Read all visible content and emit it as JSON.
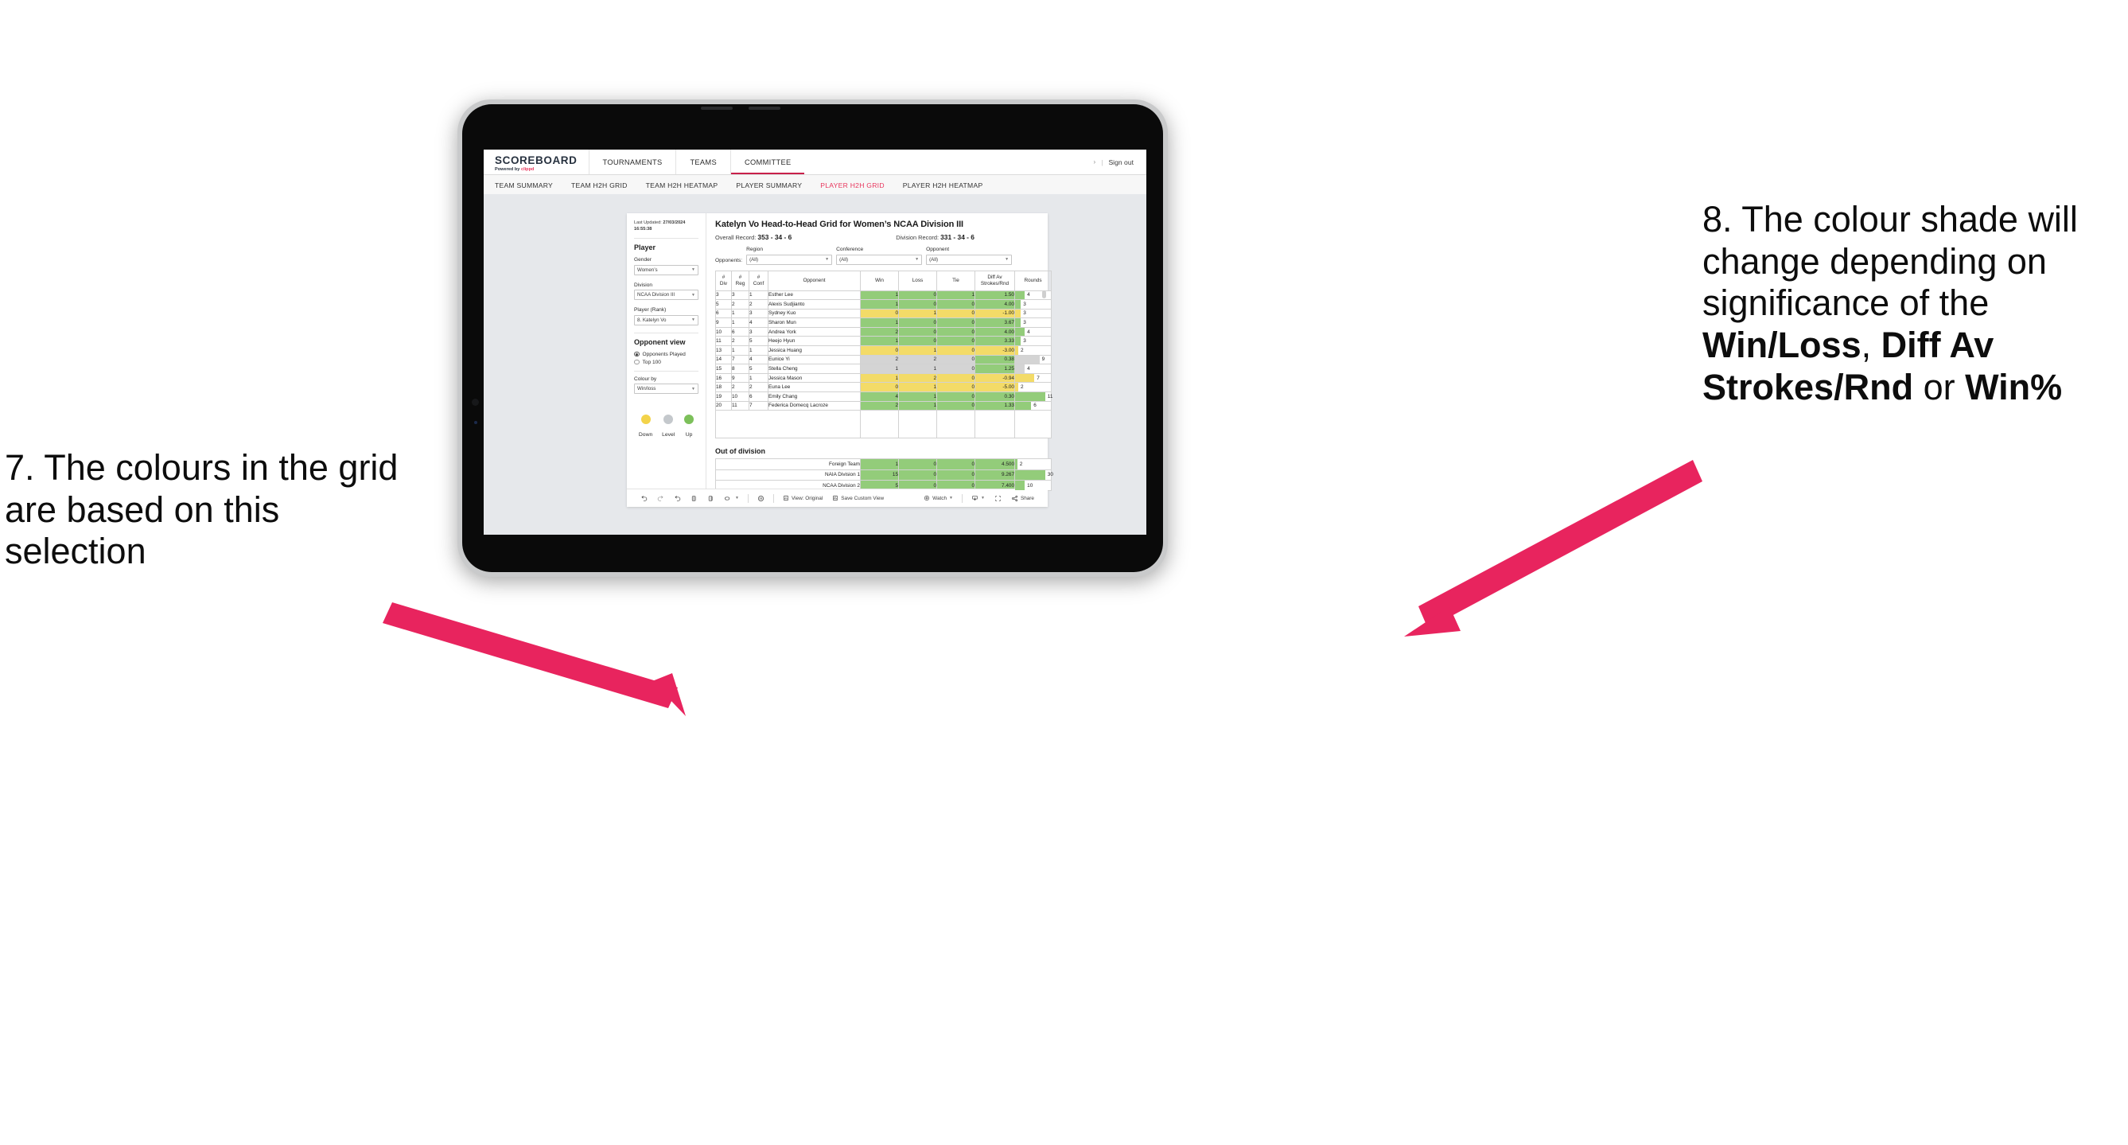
{
  "annotations": {
    "left": "7. The colours in the grid are based on this selection",
    "right_pre": "8. The colour shade will change depending on significance of the ",
    "right_b1": "Win/Loss",
    "right_mid1": ", ",
    "right_b2": "Diff Av Strokes/Rnd",
    "right_mid2": " or ",
    "right_b3": "Win%",
    "arrow_color": "#e8245e"
  },
  "app": {
    "logo": {
      "name": "SCOREBOARD",
      "tagline_pre": "Powered by ",
      "tagline_brand": "clippd"
    },
    "top_nav": [
      {
        "label": "TOURNAMENTS",
        "active": false
      },
      {
        "label": "TEAMS",
        "active": false
      },
      {
        "label": "COMMITTEE",
        "active": true
      }
    ],
    "sign_out": {
      "chevron": "›",
      "divider": "|",
      "label": "Sign out"
    },
    "sub_nav": [
      {
        "label": "TEAM SUMMARY",
        "active": false
      },
      {
        "label": "TEAM H2H GRID",
        "active": false
      },
      {
        "label": "TEAM H2H HEATMAP",
        "active": false
      },
      {
        "label": "PLAYER SUMMARY",
        "active": false
      },
      {
        "label": "PLAYER H2H GRID",
        "active": true
      },
      {
        "label": "PLAYER H2H HEATMAP",
        "active": false
      }
    ]
  },
  "sidebar": {
    "last_updated_label": "Last Updated:",
    "last_updated_date": "27/03/2024",
    "last_updated_time": "16:55:38",
    "player_heading": "Player",
    "gender": {
      "label": "Gender",
      "value": "Women’s"
    },
    "division": {
      "label": "Division",
      "value": "NCAA Division III"
    },
    "player_rank": {
      "label": "Player (Rank)",
      "value": "8. Katelyn Vo"
    },
    "opponent_view": {
      "heading": "Opponent view",
      "options": [
        {
          "label": "Opponents Played",
          "selected": true
        },
        {
          "label": "Top 100",
          "selected": false
        }
      ]
    },
    "colour_by": {
      "label": "Colour by",
      "value": "Win/loss"
    },
    "legend": [
      {
        "label": "Down",
        "color": "#f3d34a"
      },
      {
        "label": "Level",
        "color": "#c4c8cc"
      },
      {
        "label": "Up",
        "color": "#7cc05a"
      }
    ]
  },
  "main": {
    "title": "Katelyn Vo Head-to-Head Grid for Women’s NCAA Division III",
    "overall_record_label": "Overall Record:",
    "overall_record_value": "353 -  34 - 6",
    "division_record_label": "Division Record:",
    "division_record_value": "331 -  34 - 6",
    "opponents_label": "Opponents:",
    "filters": [
      {
        "label": "Region",
        "value": "(All)"
      },
      {
        "label": "Conference",
        "value": "(All)"
      },
      {
        "label": "Opponent",
        "value": "(All)"
      }
    ]
  },
  "chart_data": {
    "type": "table",
    "title": "Katelyn Vo Head-to-Head Grid for Women’s NCAA Division III",
    "columns": [
      "# Div",
      "# Reg",
      "# Conf",
      "Opponent",
      "Win",
      "Loss",
      "Tie",
      "Diff Av Strokes/Rnd",
      "Rounds"
    ],
    "column_headers_split": [
      {
        "l1": "#",
        "l2": "Div"
      },
      {
        "l1": "#",
        "l2": "Reg"
      },
      {
        "l1": "#",
        "l2": "Conf"
      },
      {
        "l1": "Opponent",
        "l2": ""
      },
      {
        "l1": "Win",
        "l2": ""
      },
      {
        "l1": "Loss",
        "l2": ""
      },
      {
        "l1": "Tie",
        "l2": ""
      },
      {
        "l1": "Diff Av",
        "l2": "Strokes/Rnd"
      },
      {
        "l1": "Rounds",
        "l2": ""
      }
    ],
    "colour_scale": {
      "up": "#93cc7a",
      "down": "#f3db68",
      "level": "#d4d4d4"
    },
    "rows": [
      {
        "div": "3",
        "reg": "3",
        "conf": "1",
        "opponent": "Esther Lee",
        "win": "1",
        "loss": "0",
        "tie": "1",
        "diff": "1.50",
        "rounds": "4",
        "shade": "g",
        "rounds_pct": 27
      },
      {
        "div": "5",
        "reg": "2",
        "conf": "2",
        "opponent": "Alexis Sudjianto",
        "win": "1",
        "loss": "0",
        "tie": "0",
        "diff": "4.00",
        "rounds": "3",
        "shade": "g",
        "rounds_pct": 16
      },
      {
        "div": "6",
        "reg": "1",
        "conf": "3",
        "opponent": "Sydney Kuo",
        "win": "0",
        "loss": "1",
        "tie": "0",
        "diff": "-1.00",
        "rounds": "3",
        "shade": "y",
        "rounds_pct": 16
      },
      {
        "div": "9",
        "reg": "1",
        "conf": "4",
        "opponent": "Sharon Mun",
        "win": "1",
        "loss": "0",
        "tie": "0",
        "diff": "3.67",
        "rounds": "3",
        "shade": "g",
        "rounds_pct": 16
      },
      {
        "div": "10",
        "reg": "6",
        "conf": "3",
        "opponent": "Andrea York",
        "win": "2",
        "loss": "0",
        "tie": "0",
        "diff": "4.00",
        "rounds": "4",
        "shade": "g",
        "rounds_pct": 27
      },
      {
        "div": "11",
        "reg": "2",
        "conf": "5",
        "opponent": "Heejo Hyun",
        "win": "1",
        "loss": "0",
        "tie": "0",
        "diff": "3.33",
        "rounds": "3",
        "shade": "g",
        "rounds_pct": 16
      },
      {
        "div": "13",
        "reg": "1",
        "conf": "1",
        "opponent": "Jessica Huang",
        "win": "0",
        "loss": "1",
        "tie": "0",
        "diff": "-3.00",
        "rounds": "2",
        "shade": "y",
        "rounds_pct": 9
      },
      {
        "div": "14",
        "reg": "7",
        "conf": "4",
        "opponent": "Eunice Yi",
        "win": "2",
        "loss": "2",
        "tie": "0",
        "diff": "0.38",
        "rounds": "9",
        "shade": "gr",
        "rounds_pct": 68,
        "diff_shade": "g"
      },
      {
        "div": "15",
        "reg": "8",
        "conf": "5",
        "opponent": "Stella Cheng",
        "win": "1",
        "loss": "1",
        "tie": "0",
        "diff": "1.25",
        "rounds": "4",
        "shade": "gr",
        "rounds_pct": 27,
        "diff_shade": "g"
      },
      {
        "div": "16",
        "reg": "9",
        "conf": "1",
        "opponent": "Jessica Mason",
        "win": "1",
        "loss": "2",
        "tie": "0",
        "diff": "-0.94",
        "rounds": "7",
        "shade": "y",
        "rounds_pct": 54
      },
      {
        "div": "18",
        "reg": "2",
        "conf": "2",
        "opponent": "Euna Lee",
        "win": "0",
        "loss": "1",
        "tie": "0",
        "diff": "-5.00",
        "rounds": "2",
        "shade": "y",
        "rounds_pct": 9
      },
      {
        "div": "19",
        "reg": "10",
        "conf": "6",
        "opponent": "Emily Chang",
        "win": "4",
        "loss": "1",
        "tie": "0",
        "diff": "0.30",
        "rounds": "11",
        "shade": "g",
        "rounds_pct": 84
      },
      {
        "div": "20",
        "reg": "11",
        "conf": "7",
        "opponent": "Federica Domecq Lacroze",
        "win": "2",
        "loss": "1",
        "tie": "0",
        "diff": "1.33",
        "rounds": "6",
        "shade": "g",
        "rounds_pct": 45
      }
    ],
    "out_of_division": {
      "heading": "Out of division",
      "rows": [
        {
          "label": "Foreign Team",
          "win": "1",
          "loss": "0",
          "tie": "0",
          "diff": "4.500",
          "rounds": "2",
          "shade": "g",
          "rounds_pct": 6
        },
        {
          "label": "NAIA Division 1",
          "win": "15",
          "loss": "0",
          "tie": "0",
          "diff": "9.267",
          "rounds": "30",
          "shade": "g",
          "rounds_pct": 84
        },
        {
          "label": "NCAA Division 2",
          "win": "5",
          "loss": "0",
          "tie": "0",
          "diff": "7.400",
          "rounds": "10",
          "shade": "g",
          "rounds_pct": 27
        }
      ]
    }
  },
  "toolbar": {
    "view_label": "View: Original",
    "save_label": "Save Custom View",
    "watch_label": "Watch",
    "share_label": "Share"
  }
}
